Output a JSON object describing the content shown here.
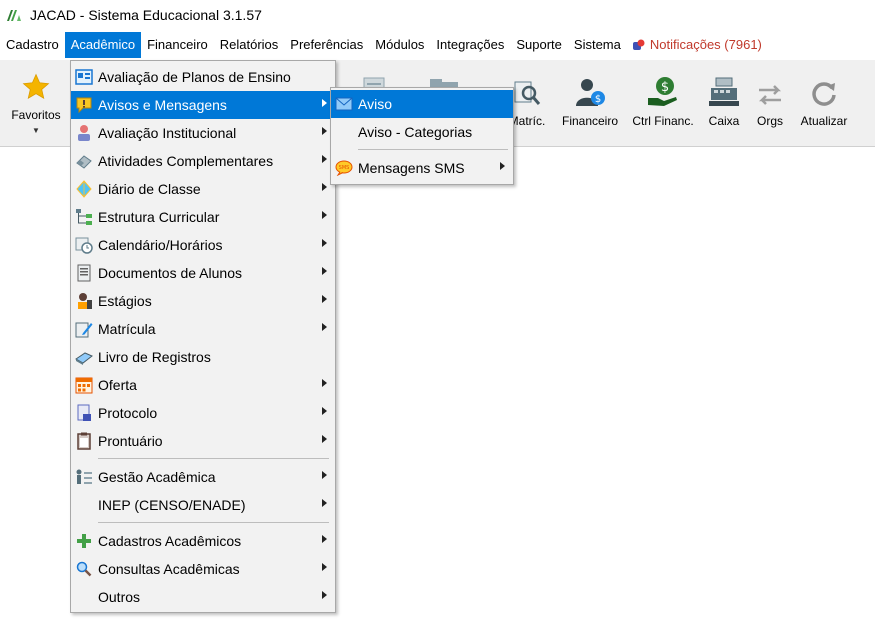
{
  "window": {
    "title": "JACAD - Sistema Educacional 3.1.57"
  },
  "menubar": {
    "items": [
      "Cadastro",
      "Acadêmico",
      "Financeiro",
      "Relatórios",
      "Preferências",
      "Módulos",
      "Integrações",
      "Suporte",
      "Sistema"
    ],
    "active_index": 1,
    "notifications": "Notificações (7961)"
  },
  "toolbar": {
    "favorites": "Favoritos",
    "buttons": [
      "Matríc.",
      "Financeiro",
      "Ctrl Financ.",
      "Caixa",
      "Orgs",
      "Atualizar"
    ]
  },
  "academico_menu": {
    "items": [
      {
        "label": "Avaliação de Planos de Ensino",
        "icon": "plan-evaluation-icon",
        "submenu": false
      },
      {
        "label": "Avisos e Mensagens",
        "icon": "warning-message-icon",
        "submenu": true,
        "highlighted": true
      },
      {
        "label": "Avaliação Institucional",
        "icon": "person-evaluation-icon",
        "submenu": true
      },
      {
        "label": "Atividades Complementares",
        "icon": "eraser-icon",
        "submenu": true
      },
      {
        "label": "Diário de Classe",
        "icon": "diamond-icon",
        "submenu": true
      },
      {
        "label": "Estrutura Curricular",
        "icon": "tree-structure-icon",
        "submenu": true
      },
      {
        "label": "Calendário/Horários",
        "icon": "calendar-clock-icon",
        "submenu": true
      },
      {
        "label": "Documentos de Alunos",
        "icon": "document-icon",
        "submenu": true
      },
      {
        "label": "Estágios",
        "icon": "intern-icon",
        "submenu": true
      },
      {
        "label": "Matrícula",
        "icon": "enrollment-pen-icon",
        "submenu": true
      },
      {
        "label": "Livro de Registros",
        "icon": "book-icon",
        "submenu": false
      },
      {
        "label": "Oferta",
        "icon": "calendar-grid-icon",
        "submenu": true
      },
      {
        "label": "Protocolo",
        "icon": "protocol-icon",
        "submenu": true
      },
      {
        "label": "Prontuário",
        "icon": "clipboard-icon",
        "submenu": true
      },
      {
        "label": "Gestão Acadêmica",
        "icon": "management-icon",
        "submenu": true
      },
      {
        "label": "INEP (CENSO/ENADE)",
        "icon": "",
        "submenu": true
      },
      {
        "label": "Cadastros Acadêmicos",
        "icon": "plus-icon",
        "submenu": true
      },
      {
        "label": "Consultas Acadêmicas",
        "icon": "magnifier-icon",
        "submenu": true
      },
      {
        "label": "Outros",
        "icon": "",
        "submenu": true
      }
    ]
  },
  "avisos_submenu": {
    "items": [
      {
        "label": "Aviso",
        "icon": "envelope-icon",
        "submenu": false,
        "highlighted": true
      },
      {
        "label": "Aviso - Categorias",
        "icon": "",
        "submenu": false
      },
      {
        "label": "Mensagens SMS",
        "icon": "sms-bubble-icon",
        "submenu": true
      }
    ]
  }
}
